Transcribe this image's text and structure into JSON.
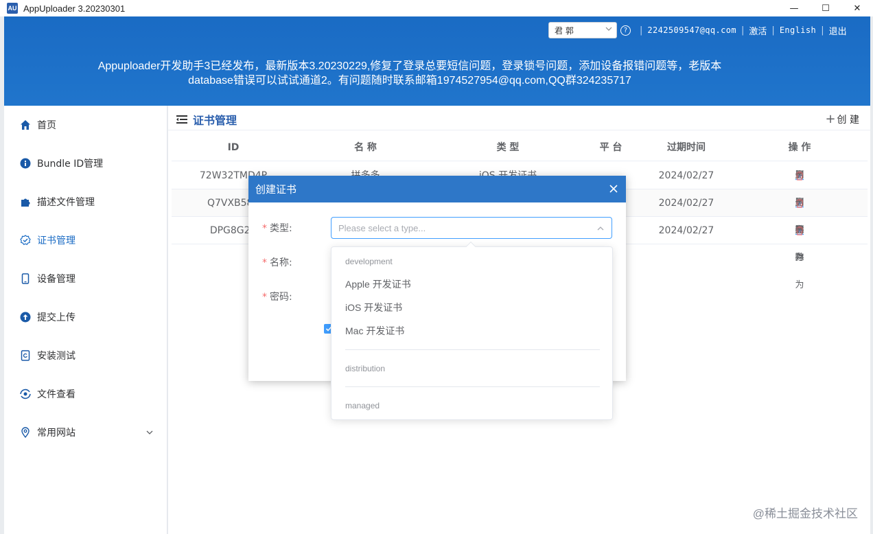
{
  "window": {
    "app_icon_text": "AU",
    "title": "AppUploader 3.20230301",
    "controls": {
      "minimize": "—",
      "maximize": "☐",
      "close": "✕"
    }
  },
  "header": {
    "user_select_value": "君 郭",
    "email": "2242509547@qq.com",
    "activate": "激活",
    "language": "English",
    "logout": "退出",
    "help_glyph": "?",
    "separator": "|",
    "notice_line1": "Appuploader开发助手3已经发布，最新版本3.20230229,修复了登录总要短信问题，登录锁号问题，添加设备报错问题等，老版本",
    "notice_line2": "database错误可以试试通道2。有问题随时联系邮箱1974527954@qq.com,QQ群324235717"
  },
  "sidebar": {
    "items": [
      {
        "label": "首页",
        "icon": "home-icon"
      },
      {
        "label": "Bundle ID管理",
        "icon": "info-icon"
      },
      {
        "label": "描述文件管理",
        "icon": "puzzle-icon"
      },
      {
        "label": "证书管理",
        "icon": "certificate-icon",
        "active": true
      },
      {
        "label": "设备管理",
        "icon": "phone-icon"
      },
      {
        "label": "提交上传",
        "icon": "upload-icon"
      },
      {
        "label": "安装测试",
        "icon": "install-icon"
      },
      {
        "label": "文件查看",
        "icon": "file-view-icon"
      },
      {
        "label": "常用网站",
        "icon": "location-icon",
        "expandable": true
      }
    ]
  },
  "main": {
    "title": "证书管理",
    "create_label": "创 建",
    "table": {
      "headers": [
        "ID",
        "名 称",
        "类 型",
        "平 台",
        "过期时间",
        "操 作"
      ],
      "rows": [
        {
          "id": "72W32TMD4P",
          "name": "拼多多",
          "type": "iOS 开发证书",
          "platform": "",
          "expires": "2024/02/27"
        },
        {
          "id": "Q7VXB58Z",
          "name": "",
          "type": "",
          "platform": "",
          "expires": "2024/02/27"
        },
        {
          "id": "DPG8G2Z",
          "name": "",
          "type": "",
          "platform": "",
          "expires": "2024/02/27"
        }
      ],
      "action_save": "另存为",
      "action_delete": "删 除"
    }
  },
  "modal": {
    "title": "创建证书",
    "required_mark": "*",
    "type_label": "类型:",
    "name_label": "名称:",
    "password_label": "密码:",
    "type_placeholder": "Please select a type..."
  },
  "dropdown": {
    "groups": [
      {
        "name": "development",
        "options": [
          "Apple 开发证书",
          "iOS 开发证书",
          "Mac 开发证书"
        ]
      },
      {
        "name": "distribution",
        "options": []
      },
      {
        "name": "managed",
        "options": []
      }
    ]
  },
  "watermark": "@稀土掘金技术社区",
  "colors": {
    "header_blue": "#1e6fc7",
    "active_blue": "#1a6bc4",
    "focus_blue": "#409eff",
    "delete_red": "#f56c6c"
  }
}
